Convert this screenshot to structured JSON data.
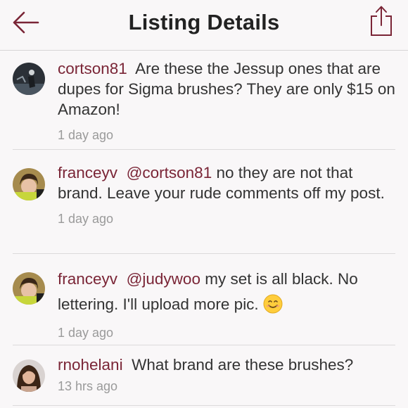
{
  "header": {
    "title": "Listing Details"
  },
  "colors": {
    "accent": "#7a2536",
    "text": "#333333",
    "muted": "#9a9a9a",
    "divider": "#dcdadb"
  },
  "icons": {
    "back": "left-arrow-icon",
    "share": "share-icon"
  },
  "comments": [
    {
      "username": "cortson81",
      "text": "Are these the Jessup ones that are dupes for Sigma brushes? They are only $15 on Amazon!",
      "time": "1 day ago"
    },
    {
      "username": "franceyv",
      "mention": "@cortson81",
      "text": "no they are not that brand. Leave your rude comments off my post.",
      "time": "1 day ago"
    },
    {
      "username": "franceyv",
      "mention": "@judywoo",
      "text": "my set is all black. No lettering. I'll upload more pic.",
      "emoji": "smiling-face-emoji",
      "time": "1 day ago"
    },
    {
      "username": "rnohelani",
      "text": "What brand are these brushes?",
      "time": "13 hrs ago"
    }
  ]
}
